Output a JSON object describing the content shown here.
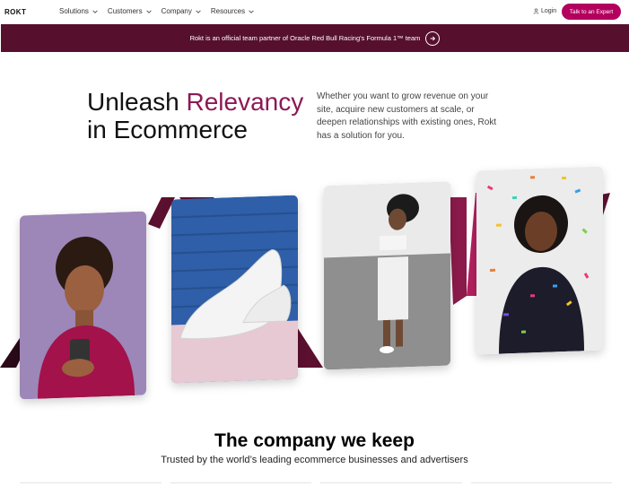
{
  "nav": {
    "logo": "ROKT",
    "menu": [
      {
        "label": "Solutions"
      },
      {
        "label": "Customers"
      },
      {
        "label": "Company"
      },
      {
        "label": "Resources"
      }
    ],
    "login_label": "Login",
    "cta_label": "Talk to an Expert"
  },
  "banner": {
    "text": "Rokt is an official team partner of Oracle Red Bull Racing's Formula 1™ team"
  },
  "hero": {
    "headline_part1": "Unleash",
    "headline_accent": "Relevancy",
    "headline_part2": "in Ecommerce",
    "description": "Whether you want to grow revenue on your site, acquire new customers at scale, or deepen relationships with existing ones, Rokt has a solution for you."
  },
  "gallery": {
    "photos": [
      {
        "subject": "woman-with-phone"
      },
      {
        "subject": "white-sneakers"
      },
      {
        "subject": "woman-in-white-outfit"
      },
      {
        "subject": "woman-with-confetti"
      }
    ]
  },
  "partners": {
    "title": "The company we keep",
    "subtitle": "Trusted by the world’s leading ecommerce businesses and advertisers"
  },
  "colors": {
    "brand": "#b3005e",
    "banner": "#56102e",
    "accent_text": "#8b1a55"
  }
}
